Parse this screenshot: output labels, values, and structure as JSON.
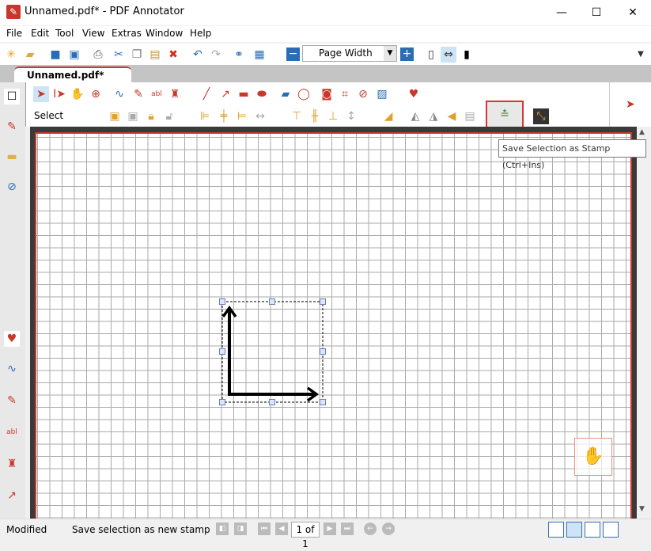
{
  "window": {
    "title": "Unnamed.pdf* - PDF Annotator",
    "minimize": "—",
    "maximize": "☐",
    "close": "✕"
  },
  "menu": [
    "File",
    "Edit",
    "Tool",
    "View",
    "Extras",
    "Window",
    "Help"
  ],
  "toolbar": {
    "zoom_mode": "Page Width"
  },
  "tabs": [
    {
      "label": "Unnamed.pdf*",
      "active": true
    }
  ],
  "annotation_toolbar": {
    "mode_label": "Select"
  },
  "tooltip": "Save Selection as Stamp (Ctrl+Ins)",
  "status": {
    "state": "Modified",
    "message": "Save selection as new stamp",
    "page": "1 of 1"
  },
  "colors": {
    "accent": "#c8382a",
    "highlight": "#e03030",
    "selection": "#6b7fc0"
  }
}
